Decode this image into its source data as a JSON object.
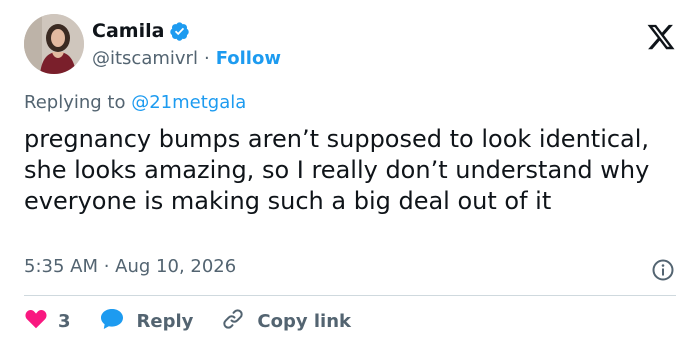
{
  "user": {
    "display_name": "Camila",
    "handle": "@itscamivrl",
    "separator": "·",
    "follow_label": "Follow",
    "verified_color": "#1d9bf0"
  },
  "reply": {
    "prefix": "Replying to ",
    "mention": "@21metgala"
  },
  "tweet": {
    "text": "pregnancy bumps aren’t supposed to look identical, she looks amazing, so I really don’t understand why everyone is making such a big deal out of it"
  },
  "meta": {
    "time": "5:35 AM",
    "separator": " · ",
    "date": "Aug 10, 2026"
  },
  "actions": {
    "like_count": "3",
    "reply_label": "Reply",
    "copy_label": "Copy link"
  },
  "colors": {
    "accent": "#1d9bf0",
    "heart": "#f91880",
    "muted": "#536471"
  },
  "icons": [
    "verified-badge-icon",
    "x-logo-icon",
    "info-icon",
    "heart-icon",
    "reply-bubble-icon",
    "link-icon"
  ]
}
